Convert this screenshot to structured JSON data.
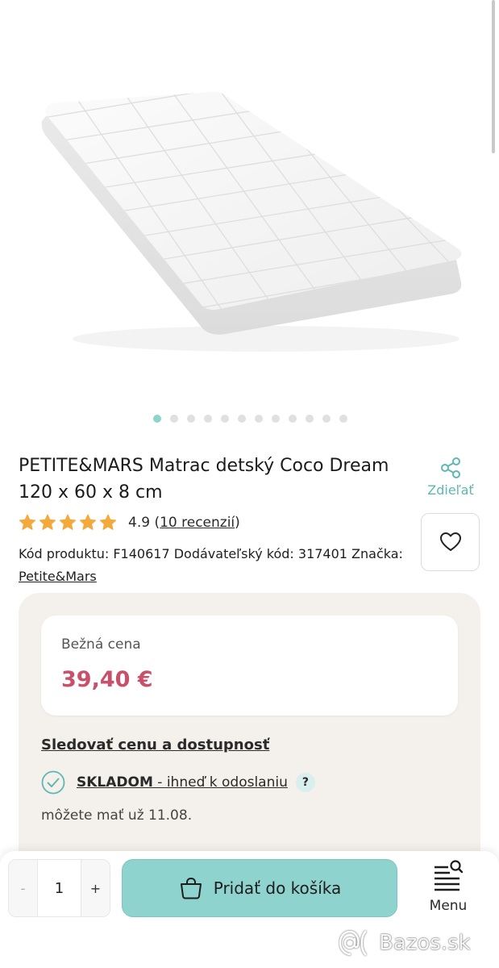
{
  "product": {
    "title": "PETITE&MARS Matrac detský Coco Dream 120 x 60 x 8 cm",
    "image_alt": "white quilted baby mattress",
    "gallery": {
      "count": 12,
      "active_index": 0
    },
    "rating": {
      "score": "4.9",
      "stars": 5,
      "reviews_link": "10 recenzií",
      "open_paren": "(",
      "close_paren": ")"
    },
    "codes_text": "Kód produktu: F140617 Dodávateľský kód: 317401 Značka:",
    "brand": "Petite&Mars"
  },
  "actions": {
    "share_label": "Zdieľať",
    "share_icon": "share-icon",
    "wishlist_icon": "heart-icon"
  },
  "price": {
    "label": "Bežná cena",
    "value": "39,40 €",
    "color": "#c8506b"
  },
  "availability": {
    "track_link": "Sledovať cenu a dostupnosť",
    "status_bold": "SKLADOM",
    "status_rest": " - ihneď k odoslaniu",
    "help": "?",
    "delivery": "môžete mať už 11.08."
  },
  "cart": {
    "minus": "-",
    "quantity": "1",
    "plus": "+",
    "add_label": "Pridať do košíka",
    "menu_label": "Menu"
  },
  "colors": {
    "accent": "#8fd3cf",
    "accent_text": "#5fb7b2",
    "star": "#f3a93b",
    "panel": "#f4f1ec"
  },
  "watermark": "Bazos.sk"
}
